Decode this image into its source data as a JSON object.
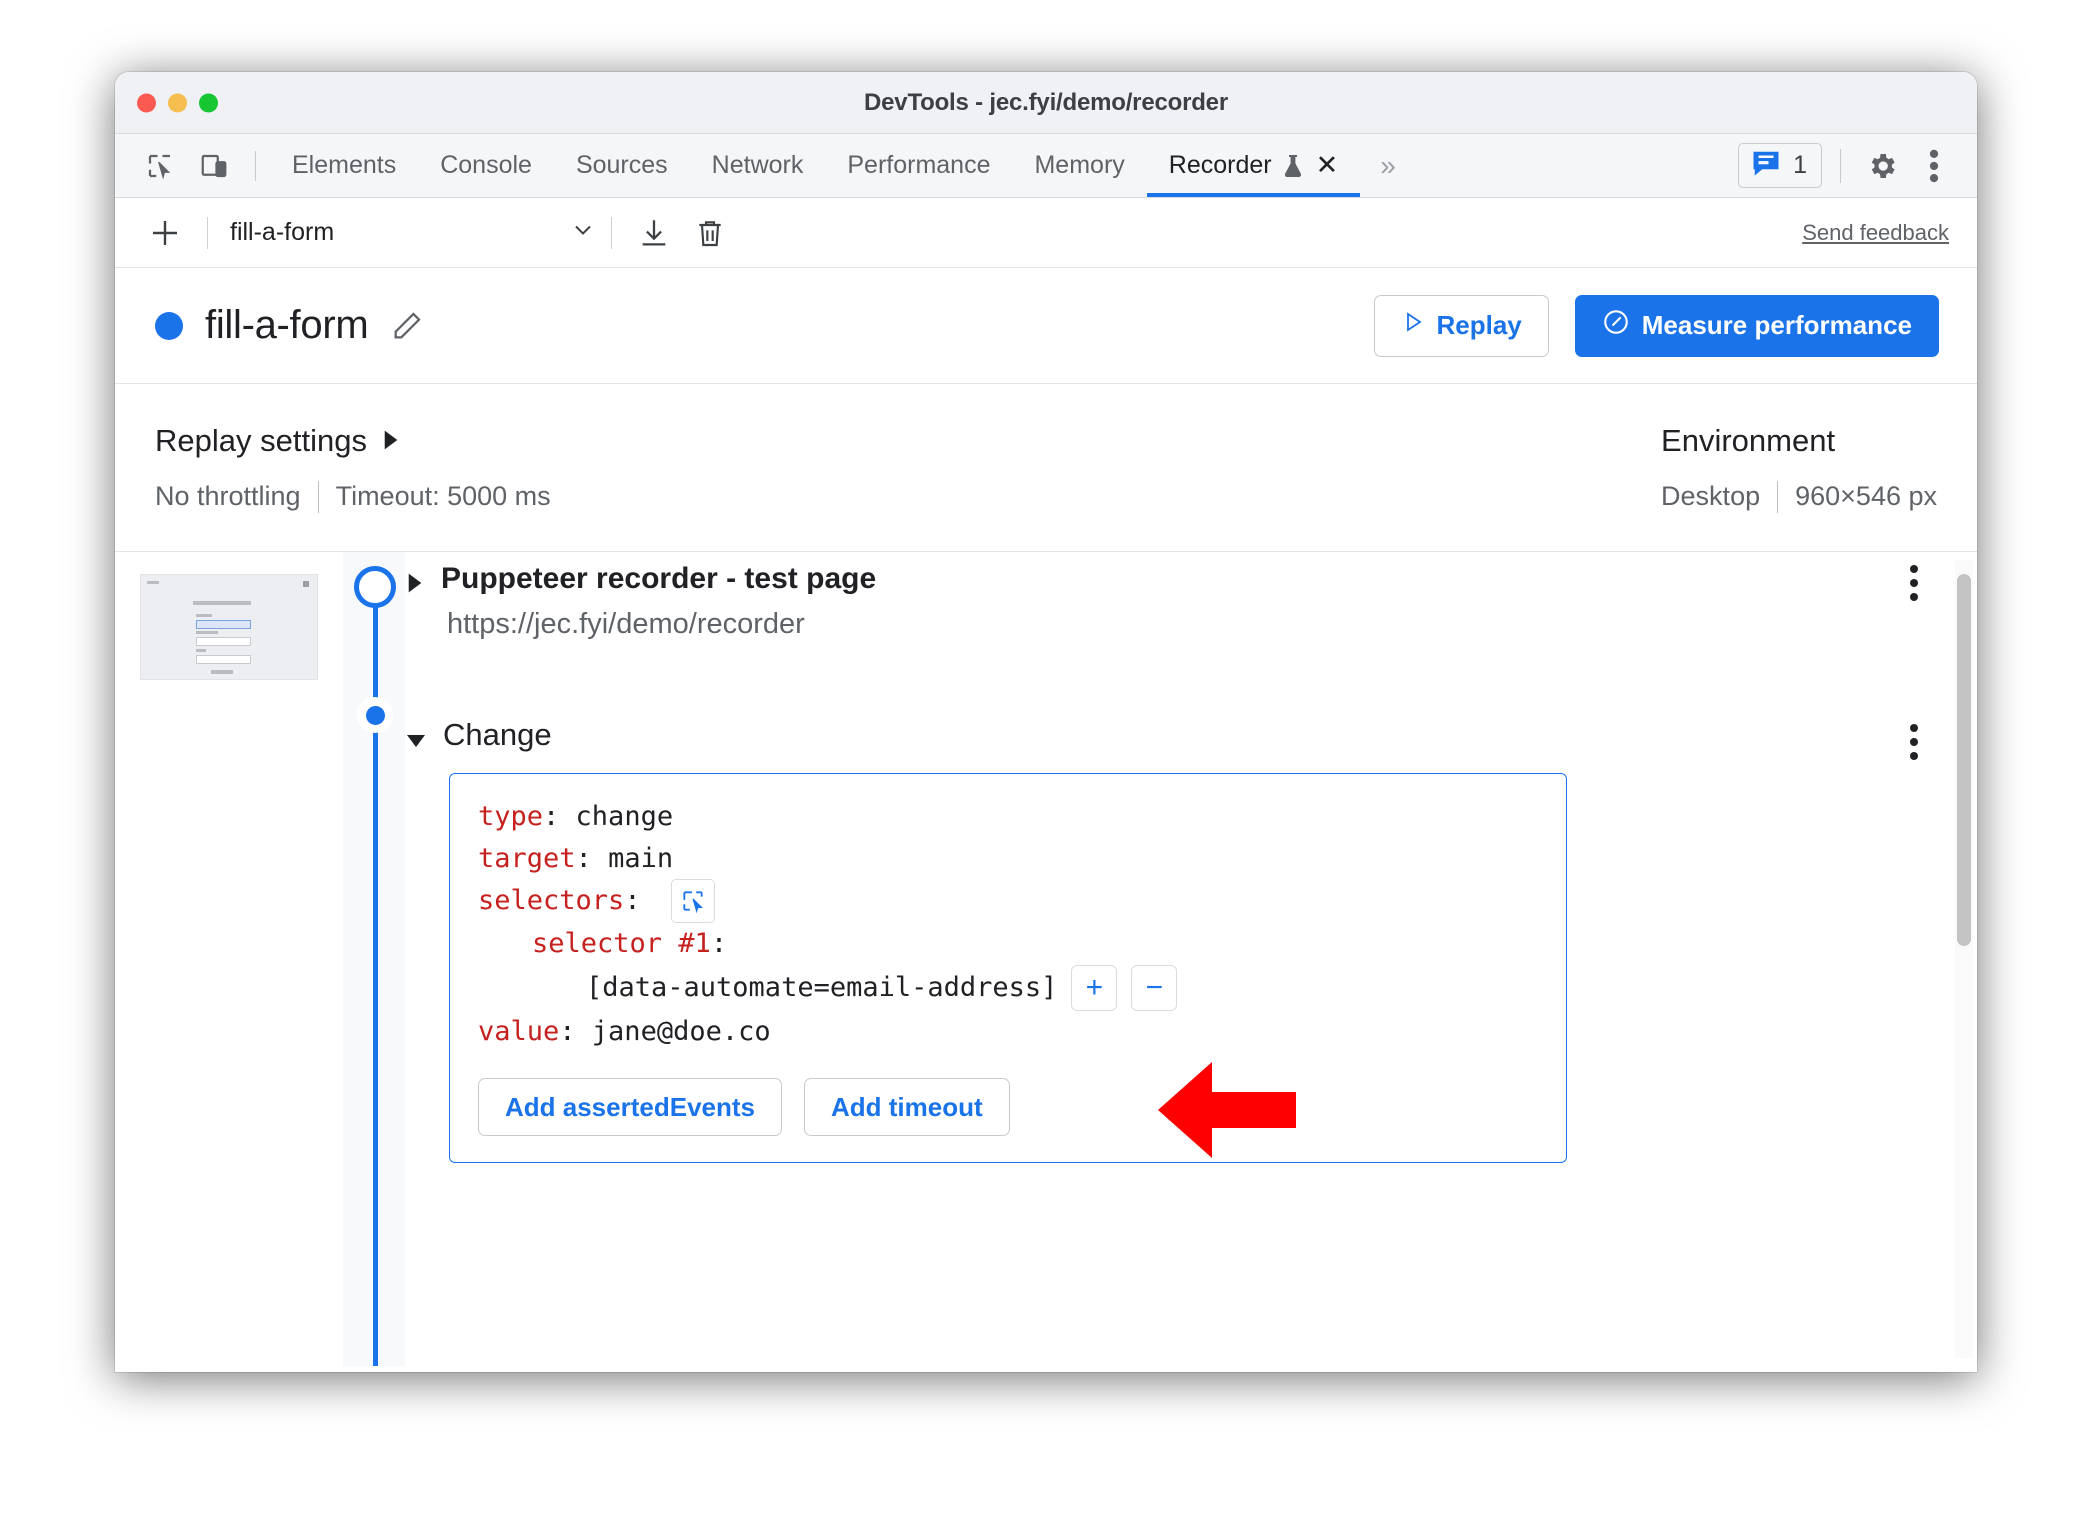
{
  "window": {
    "title": "DevTools - jec.fyi/demo/recorder",
    "traffic_lights": [
      "close-red",
      "minimize-yellow",
      "maximize-green"
    ]
  },
  "tabbar": {
    "inspect_icon": "inspect-element-icon",
    "device_icon": "device-toolbar-icon",
    "tabs": [
      {
        "label": "Elements",
        "active": false
      },
      {
        "label": "Console",
        "active": false
      },
      {
        "label": "Sources",
        "active": false
      },
      {
        "label": "Network",
        "active": false
      },
      {
        "label": "Performance",
        "active": false
      },
      {
        "label": "Memory",
        "active": false
      },
      {
        "label": "Recorder",
        "active": true,
        "experiment_icon": "flask-icon",
        "close_icon": "close-icon"
      }
    ],
    "overflow_label": "»",
    "messages": {
      "icon": "message-icon",
      "count": "1"
    },
    "settings_icon": "gear-icon",
    "more_icon": "kebab-menu-icon"
  },
  "toolbar": {
    "add_icon": "plus-icon",
    "recording_select_value": "fill-a-form",
    "chevron_icon": "chevron-down-icon",
    "export_icon": "download-icon",
    "delete_icon": "trash-icon",
    "feedback_label": "Send feedback"
  },
  "header": {
    "status_color": "#1a73e8",
    "recording_name": "fill-a-form",
    "edit_icon": "pencil-icon",
    "replay_label": "Replay",
    "replay_icon": "play-triangle-icon",
    "measure_label": "Measure performance",
    "measure_icon": "performance-gauge-icon"
  },
  "settings": {
    "replay": {
      "title": "Replay settings",
      "expander_icon": "triangle-right-icon",
      "throttling": "No throttling",
      "timeout": "Timeout: 5000 ms"
    },
    "environment": {
      "title": "Environment",
      "device": "Desktop",
      "viewport": "960×546 px"
    }
  },
  "steps": {
    "thumbnail_name": "step-screenshot-thumbnail",
    "navigate": {
      "expander_icon": "triangle-right-icon",
      "title": "Puppeteer recorder - test page",
      "url": "https://jec.fyi/demo/recorder",
      "menu_icon": "kebab-menu-icon"
    },
    "change": {
      "expander_icon": "triangle-down-icon",
      "title": "Change",
      "menu_icon": "kebab-menu-icon",
      "fields": {
        "type_key": "type",
        "type_value": "change",
        "target_key": "target",
        "target_value": "main",
        "selectors_key": "selectors",
        "selectors_picker_icon": "select-element-icon",
        "selector_index_key": "selector #1",
        "selector_value": "[data-automate=email-address]",
        "add_selector_label": "+",
        "remove_selector_label": "−",
        "value_key": "value",
        "value_value": "jane@doe.co"
      },
      "add_asserted_events_label": "Add assertedEvents",
      "add_timeout_label": "Add timeout"
    }
  },
  "annotation": {
    "arrow_name": "red-pointer-arrow",
    "arrow_color": "#ff0000"
  }
}
